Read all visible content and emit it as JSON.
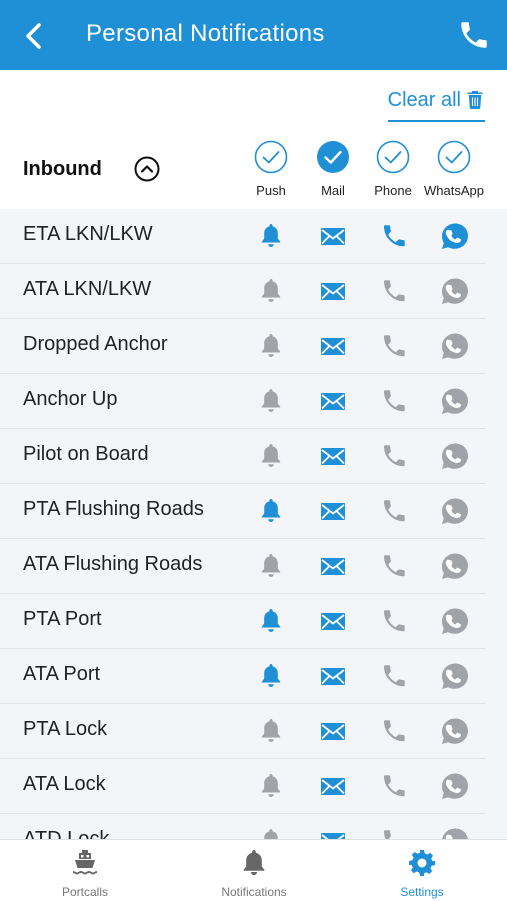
{
  "header": {
    "title": "Personal Notifications"
  },
  "clear_all": {
    "label": "Clear all"
  },
  "section": {
    "label": "Inbound",
    "channels": [
      {
        "label": "Push",
        "checked": false
      },
      {
        "label": "Mail",
        "checked": true
      },
      {
        "label": "Phone",
        "checked": false
      },
      {
        "label": "WhatsApp",
        "checked": false
      }
    ]
  },
  "colors": {
    "active": "#1f8fd6",
    "inactive": "#a0a4a8",
    "header": "#1f8fd6"
  },
  "rows": [
    {
      "name": "ETA LKN/LKW",
      "push": true,
      "mail": true,
      "phone": true,
      "whatsapp": true
    },
    {
      "name": "ATA LKN/LKW",
      "push": false,
      "mail": true,
      "phone": false,
      "whatsapp": false
    },
    {
      "name": "Dropped Anchor",
      "push": false,
      "mail": true,
      "phone": false,
      "whatsapp": false
    },
    {
      "name": "Anchor Up",
      "push": false,
      "mail": true,
      "phone": false,
      "whatsapp": false
    },
    {
      "name": "Pilot on Board",
      "push": false,
      "mail": true,
      "phone": false,
      "whatsapp": false
    },
    {
      "name": "PTA Flushing Roads",
      "push": true,
      "mail": true,
      "phone": false,
      "whatsapp": false
    },
    {
      "name": "ATA Flushing Roads",
      "push": false,
      "mail": true,
      "phone": false,
      "whatsapp": false
    },
    {
      "name": "PTA Port",
      "push": true,
      "mail": true,
      "phone": false,
      "whatsapp": false
    },
    {
      "name": "ATA Port",
      "push": true,
      "mail": true,
      "phone": false,
      "whatsapp": false
    },
    {
      "name": "PTA Lock",
      "push": false,
      "mail": true,
      "phone": false,
      "whatsapp": false
    },
    {
      "name": "ATA Lock",
      "push": false,
      "mail": true,
      "phone": false,
      "whatsapp": false
    },
    {
      "name": "ATD Lock",
      "push": false,
      "mail": true,
      "phone": false,
      "whatsapp": false
    }
  ],
  "tabs": [
    {
      "label": "Portcalls",
      "icon": "ship-icon",
      "active": false
    },
    {
      "label": "Notifications",
      "icon": "bell-icon",
      "active": false
    },
    {
      "label": "Settings",
      "icon": "gear-icon",
      "active": true
    }
  ]
}
